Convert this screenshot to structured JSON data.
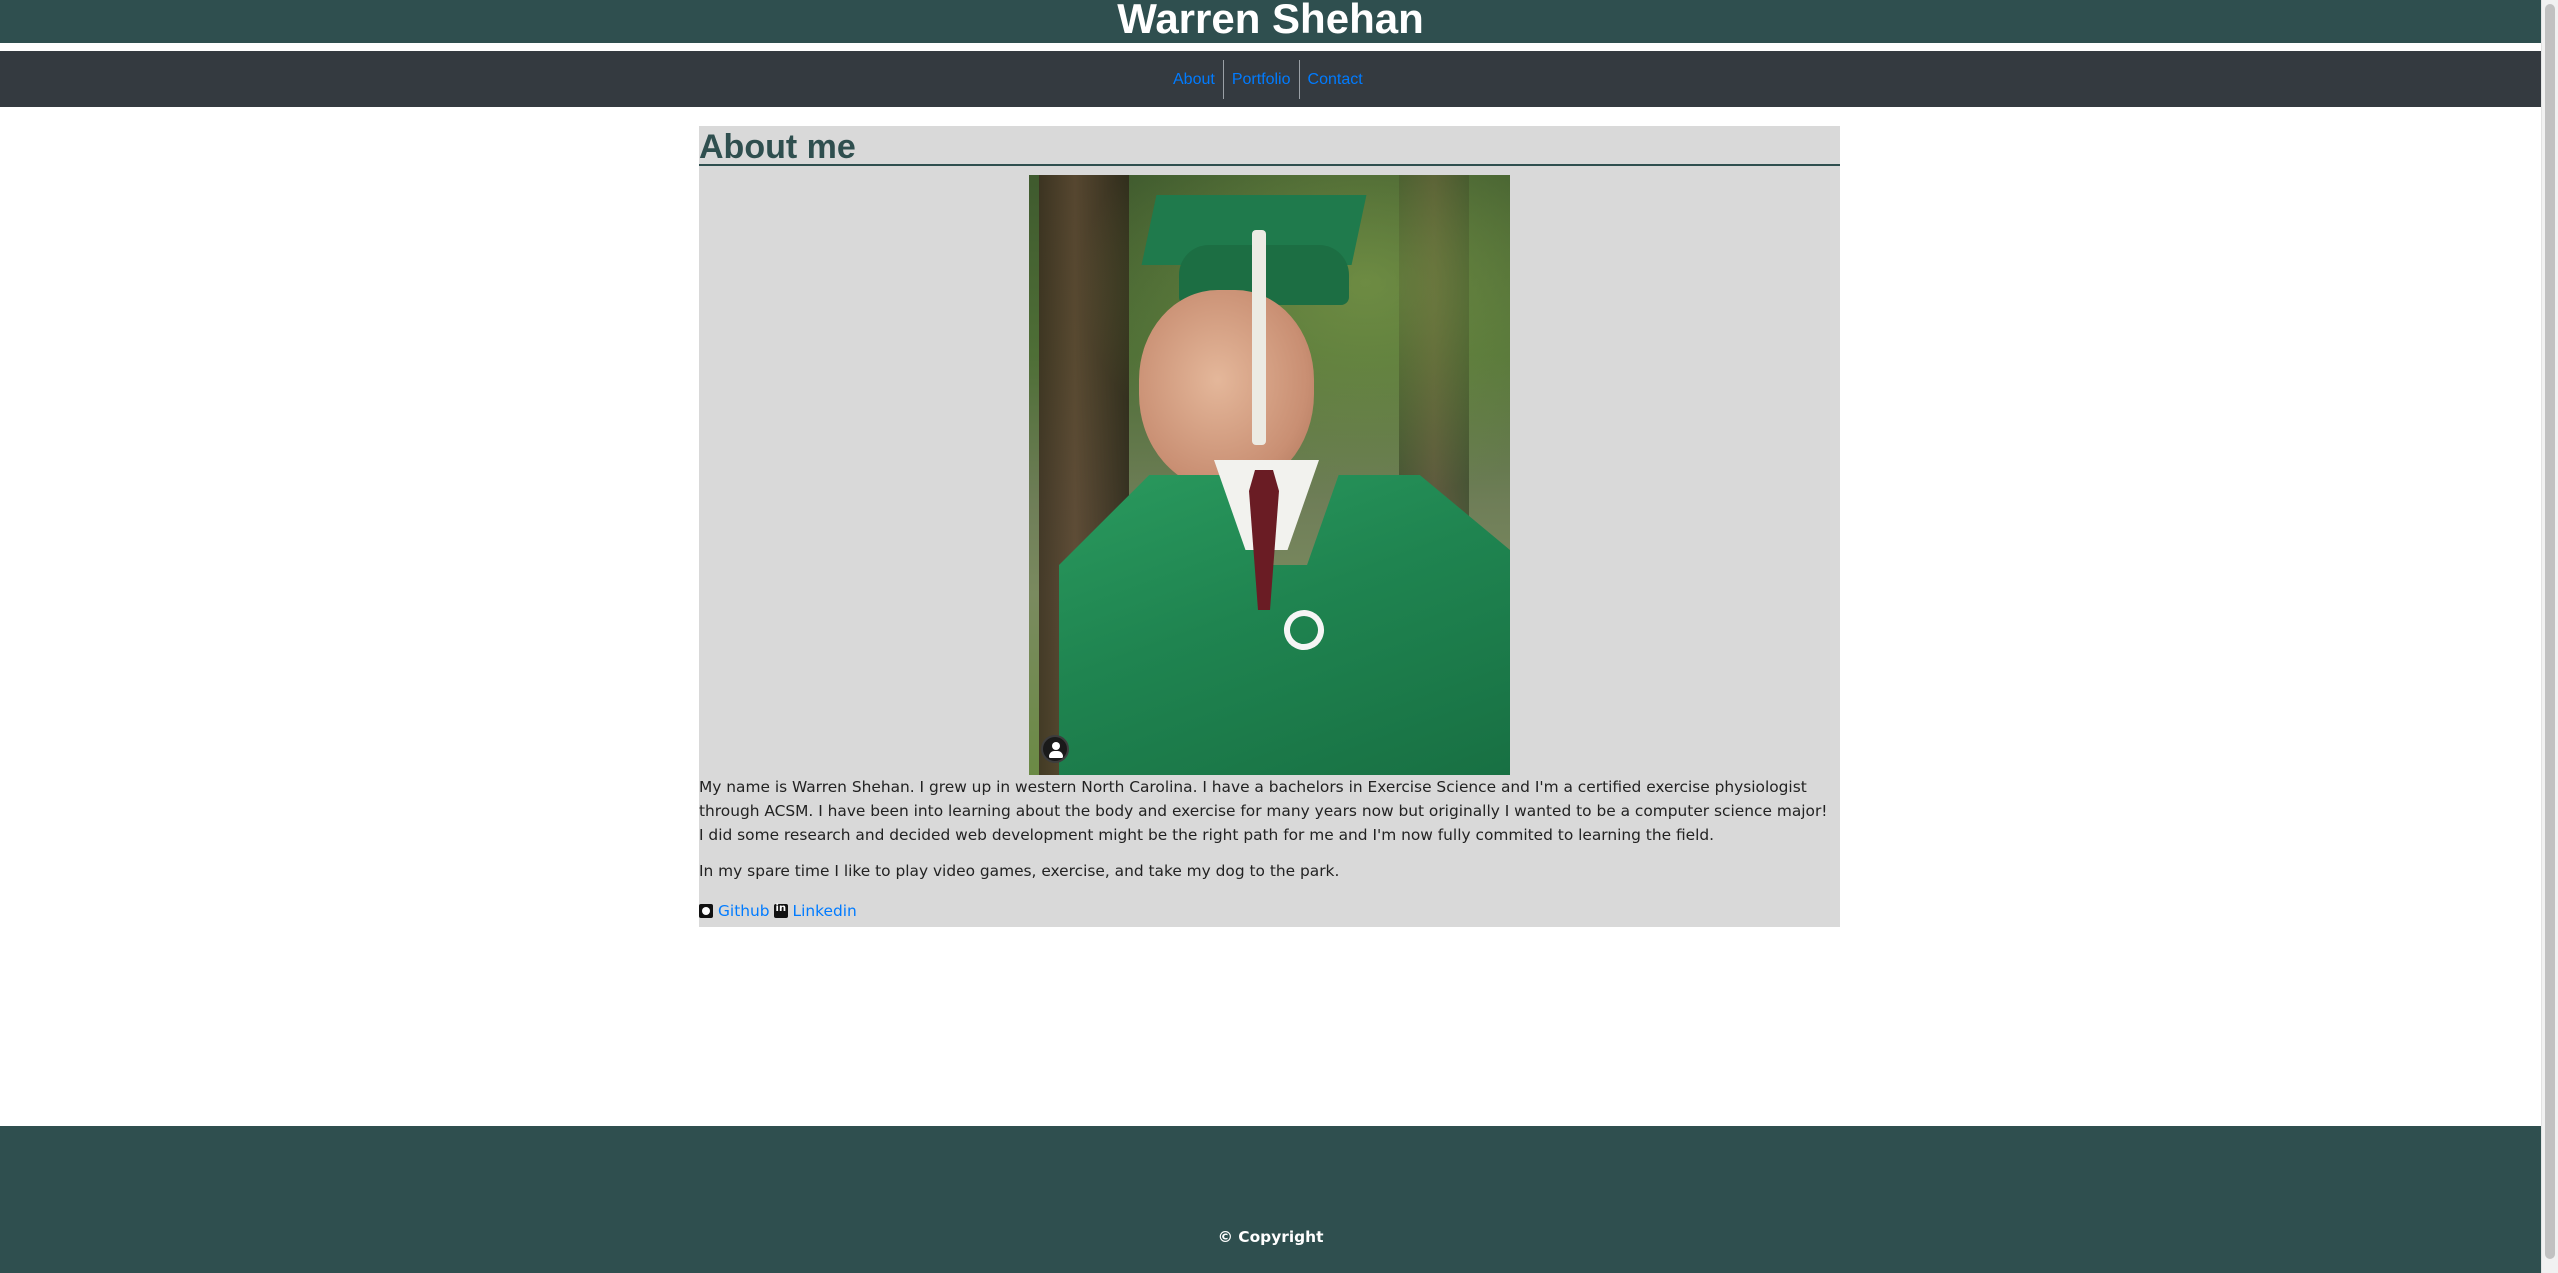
{
  "header": {
    "title": "Warren Shehan"
  },
  "nav": {
    "items": [
      "About",
      "Portfolio",
      "Contact"
    ]
  },
  "about": {
    "heading": "About me",
    "paragraph_1": "My name is Warren Shehan. I grew up in western North Carolina. I have a bachelors in Exercise Science and I'm a certified exercise physiologist through ACSM. I have been into learning about the body and exercise for many years now but originally I wanted to be a computer science major! I did some research and decided web development might be the right path for me and I'm now fully commited to learning the field.",
    "paragraph_2": "In my spare time I like to play video games, exercise, and take my dog to the park."
  },
  "links": {
    "github": {
      "label": "Github",
      "icon": "github-icon"
    },
    "linkedin": {
      "label": "Linkedin",
      "icon": "linkedin-icon"
    }
  },
  "footer": {
    "copyright": "© Copyright"
  },
  "colors": {
    "header_bg": "#2f4f4f",
    "nav_bg": "#343a40",
    "link": "#007bff",
    "section_bg": "#d9d9d9"
  }
}
